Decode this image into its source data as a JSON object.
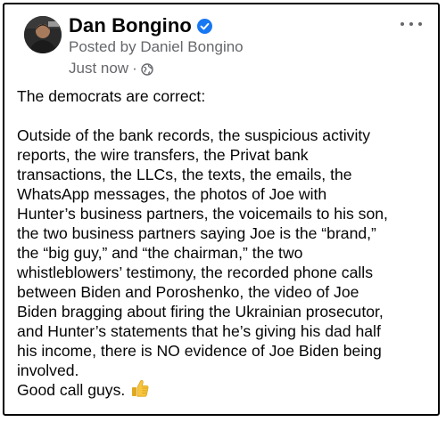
{
  "post": {
    "author": "Dan Bongino",
    "posted_by": "Posted by Daniel Bongino",
    "timestamp": "Just now",
    "separator": "·",
    "privacy_icon": "globe-icon",
    "verified_icon": "verified-badge-icon",
    "more_icon": "more-options-icon",
    "body_intro": "The democrats are correct:",
    "body_lines": [
      "Outside of the bank records, the suspicious activity",
      "reports, the wire transfers, the Privat bank",
      "transactions, the LLCs, the texts, the emails, the",
      "WhatsApp messages, the photos of Joe with",
      "Hunter’s business partners, the voicemails to his son,",
      "the two business partners saying Joe is the “brand,”",
      "the “big guy,” and “the chairman,” the two",
      "whistleblowers’ testimony, the recorded phone calls",
      "between Biden and Poroshenko, the video of Joe",
      "Biden bragging about firing the Ukrainian prosecutor,",
      "and Hunter’s statements that he’s giving his dad half",
      "his income, there is NO evidence of Joe Biden being",
      "involved."
    ],
    "closing": "Good call guys.",
    "closing_emoji": "thumbs-up-icon"
  },
  "colors": {
    "text": "#050505",
    "secondary": "#65676b",
    "verified": "#1877f2",
    "thumb": "#f7c53e",
    "border": "#000000"
  }
}
